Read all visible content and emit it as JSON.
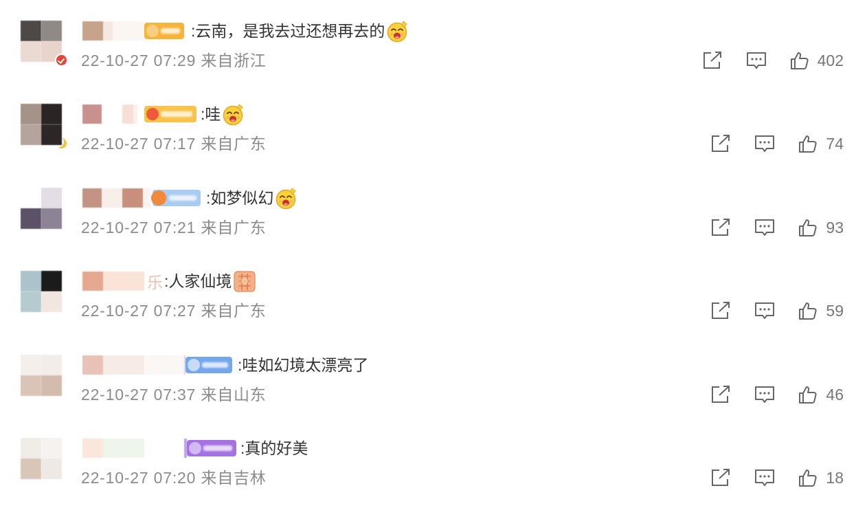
{
  "comments": [
    {
      "text": ":云南，是我去过还想再去的",
      "meta": "22-10-27 07:29 来自浙江",
      "likes": "402",
      "avatar": [
        "#4e4946",
        "#8f8a86",
        "#ebdad2",
        "#e8d4ca"
      ],
      "badge_color": "#f7b43b",
      "emoji": "laugh-emoji-icon"
    },
    {
      "text": ":哇",
      "meta": "22-10-27 07:17 来自广东",
      "likes": "74",
      "avatar": [
        "#a59389",
        "#2a2425",
        "#b4a49d",
        "#2c2627"
      ],
      "badge_color": "#f9c24a",
      "emoji": "laugh-emoji-icon"
    },
    {
      "text": ":如梦似幻",
      "meta": "22-10-27 07:21 来自广东",
      "likes": "93",
      "avatar": [
        "#ffffff",
        "#e3dde5",
        "#5c5268",
        "#8c8396"
      ],
      "badge_color": "#aacbf2",
      "emoji": "laugh-emoji-icon"
    },
    {
      "name_tail": "乐",
      "text": ":人家仙境",
      "meta": "22-10-27 07:27 来自广东",
      "likes": "59",
      "avatar": [
        "#abc3cb",
        "#1b1b1b",
        "#b5cbd0",
        "#f1e6e0"
      ],
      "emoji": "sticker-emoji-icon"
    },
    {
      "text": ":哇如幻境太漂亮了",
      "meta": "22-10-27 07:37 来自山东",
      "likes": "46",
      "avatar": [
        "#f4efeb",
        "#f2ede9",
        "#dac3b7",
        "#d3bbad"
      ],
      "badge_color": "#74a6ec"
    },
    {
      "text": ":真的好美",
      "meta": "22-10-27 07:20 来自吉林",
      "likes": "18",
      "avatar": [
        "#f0ece8",
        "#f6f2f0",
        "#dac6b8",
        "#eee9e5"
      ],
      "badge_color": "#a472e2"
    }
  ],
  "icons": {
    "share": "share-icon",
    "comment": "comment-icon",
    "like": "thumbs-up-icon"
  },
  "colors": {
    "text": "#333333",
    "meta": "#8b8b8b",
    "icon": "#666666"
  }
}
